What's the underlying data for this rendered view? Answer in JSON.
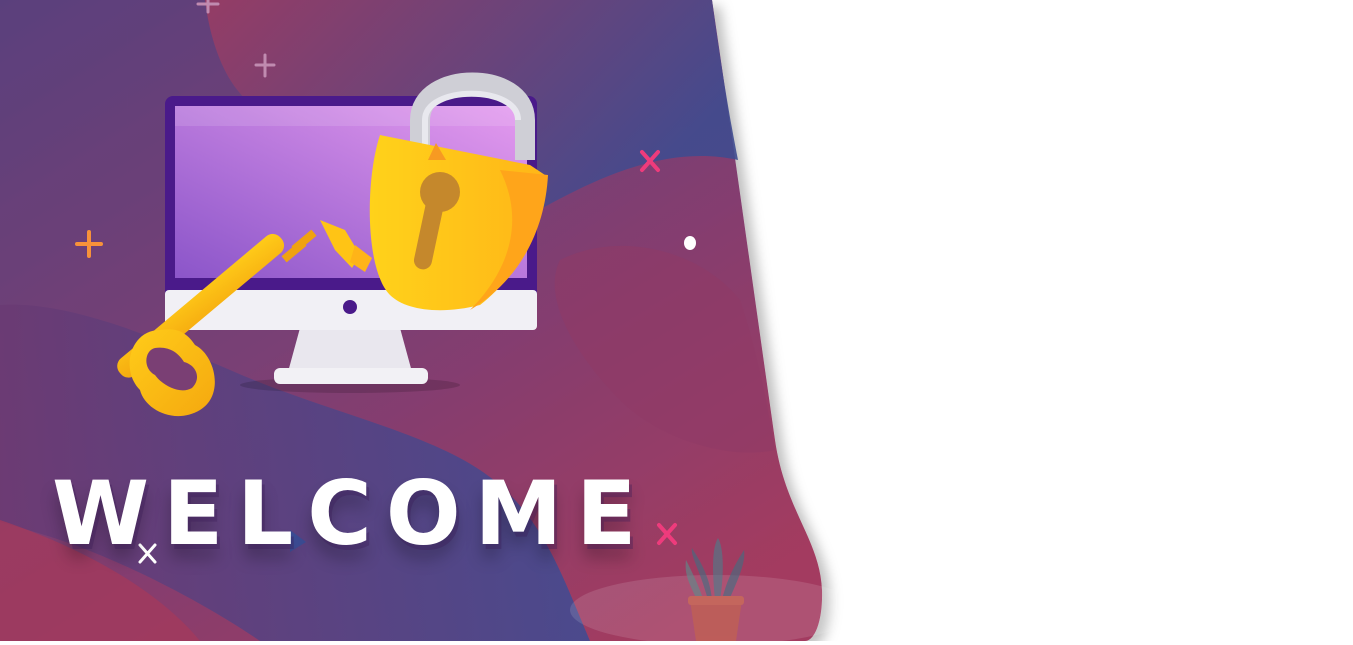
{
  "hero": {
    "heading": "WELCOME",
    "illustration": {
      "monitor_icon": "monitor-icon",
      "padlock_icon": "padlock-icon",
      "key_icon": "key-icon",
      "plant_icon": "plant-pot-icon"
    },
    "colors": {
      "gradient_top": "#4a4a8c",
      "gradient_mid": "#7a3f74",
      "gradient_bottom": "#a43a5e",
      "accent_blue": "#3d4e96",
      "lock_yellow": "#ffc915",
      "screen_purple": "#a96ad6",
      "sparkle_pink": "#ee3b7c",
      "sparkle_orange": "#f7923a"
    }
  }
}
